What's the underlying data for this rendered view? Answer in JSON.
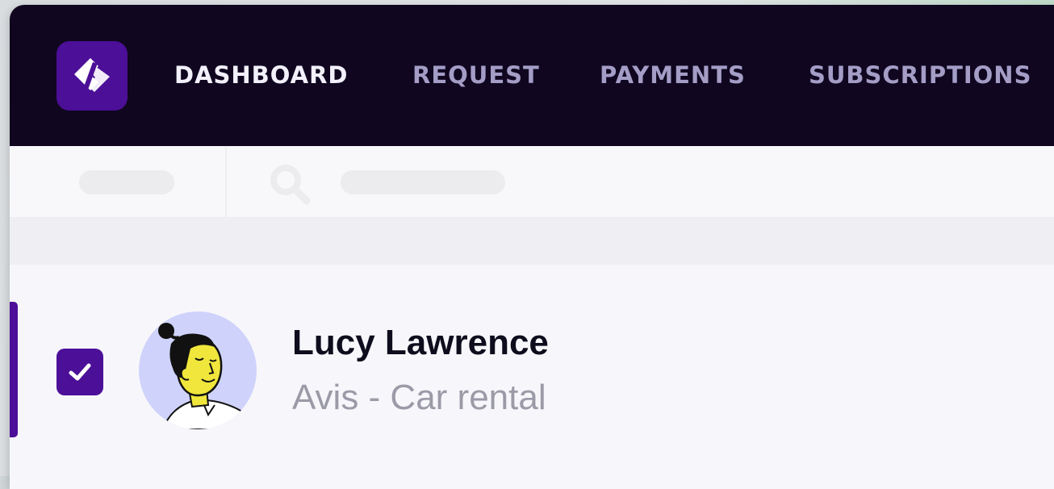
{
  "nav": {
    "logo_icon": "exchange-arrows-icon",
    "items": [
      {
        "label": "DASHBOARD",
        "active": true
      },
      {
        "label": "REQUEST",
        "active": false
      },
      {
        "label": "PAYMENTS",
        "active": false
      },
      {
        "label": "SUBSCRIPTIONS",
        "active": false
      }
    ]
  },
  "filter_bar": {
    "search_icon": "search-icon"
  },
  "row": {
    "selected": true,
    "name": "Lucy Lawrence",
    "subtitle": "Avis - Car rental",
    "avatar_icon": "person-avatar-illustration"
  },
  "colors": {
    "nav_background": "#100620",
    "brand_purple": "#4c0f97",
    "nav_active_text": "#f2f0fb",
    "nav_inactive_text": "#a49dc6",
    "avatar_background": "#cfd3fb"
  }
}
